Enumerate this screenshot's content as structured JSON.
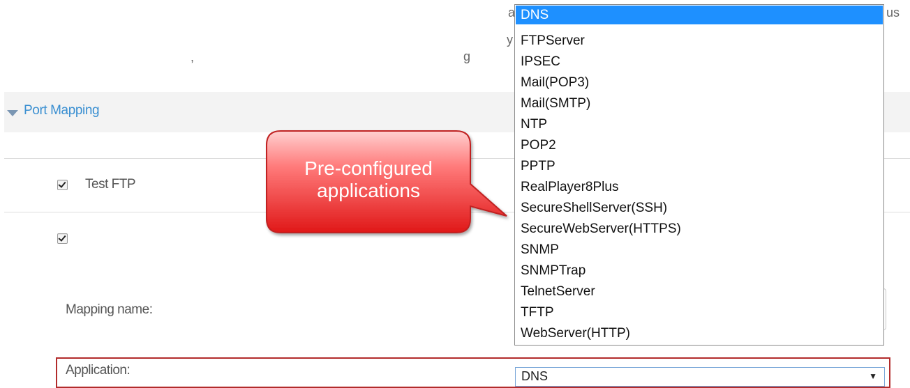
{
  "page": {
    "partial_text_fragments": [
      "a",
      "us",
      "y",
      ",",
      "g"
    ]
  },
  "section": {
    "title": "Port Mapping"
  },
  "mappings": [
    {
      "label": "Test FTP",
      "checked": true
    },
    {
      "label": "",
      "checked": true
    }
  ],
  "form": {
    "mapping_name_label": "Mapping name:",
    "application_label": "Application:",
    "application_value": "DNS"
  },
  "dropdown": {
    "selected": "DNS",
    "options": [
      "DNS",
      "FTPServer",
      "IPSEC",
      "Mail(POP3)",
      "Mail(SMTP)",
      "NTP",
      "POP2",
      "PPTP",
      "RealPlayer8Plus",
      "SecureShellServer(SSH)",
      "SecureWebServer(HTTPS)",
      "SNMP",
      "SNMPTrap",
      "TelnetServer",
      "TFTP",
      "WebServer(HTTP)"
    ]
  },
  "callout": {
    "text": "Pre-configured applications",
    "colors": {
      "fill_top": "#ff9a9a",
      "fill_bottom": "#e11a1a",
      "text": "#ffffff"
    }
  },
  "colors": {
    "accent": "#3a8fd1",
    "selected_option_bg": "#1e90ff",
    "highlight_border": "#b22b2b"
  }
}
